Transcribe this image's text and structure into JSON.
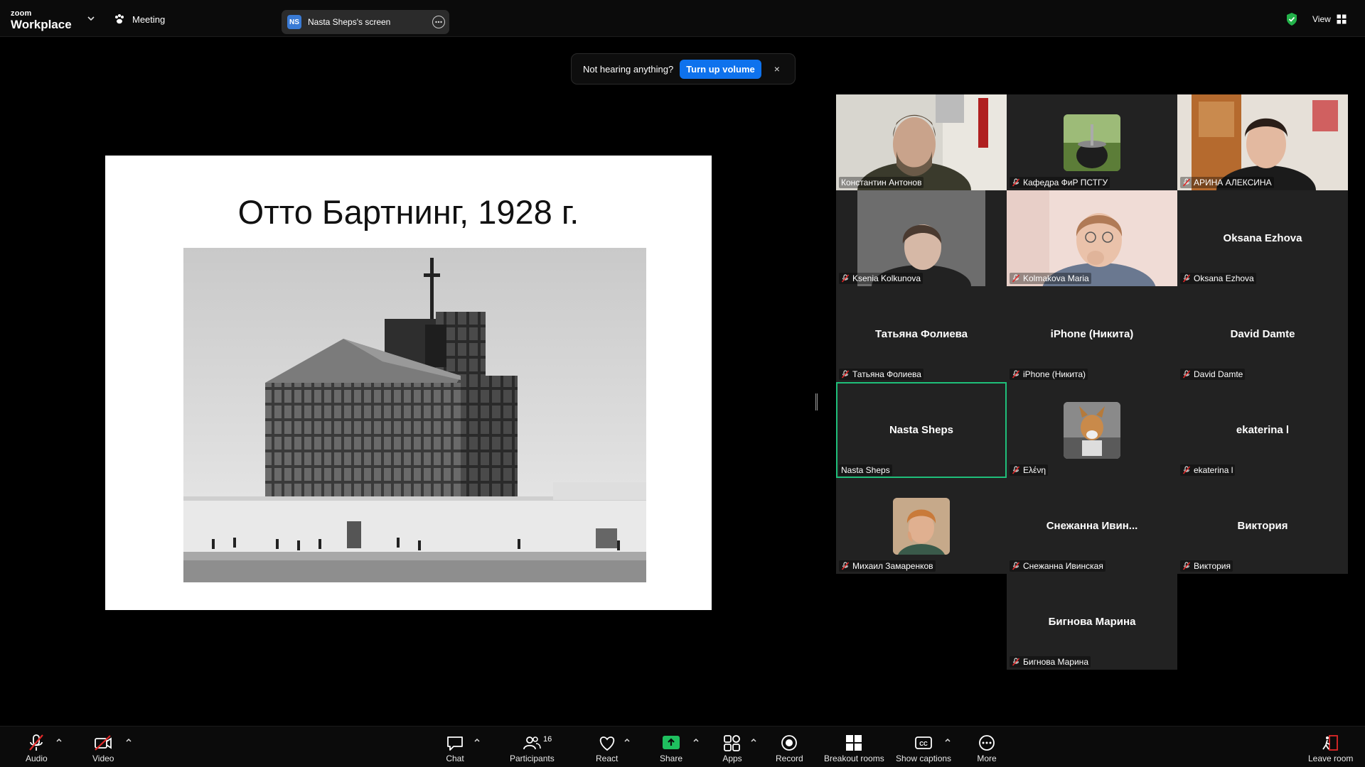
{
  "app": {
    "brand_small": "zoom",
    "brand_big": "Workplace"
  },
  "topbar": {
    "meeting_label": "Meeting",
    "screen_badge": "NS",
    "screen_title": "Nasta Sheps's screen",
    "view_label": "View"
  },
  "toast": {
    "message": "Not hearing anything?",
    "button": "Turn up volume",
    "close": "×"
  },
  "slide": {
    "title": "Отто Бартнинг, 1928 г."
  },
  "participants": [
    {
      "name": "Константин Антонов",
      "big": "",
      "muted": false,
      "video": "man-beard"
    },
    {
      "name": "Кафедра ФиР ПСТГУ",
      "big": "",
      "muted": true,
      "video": "avatar-mate"
    },
    {
      "name": "АРИНА АЛЕКСИНА",
      "big": "",
      "muted": true,
      "video": "woman-room"
    },
    {
      "name": "Ksenia Kolkunova",
      "big": "",
      "muted": true,
      "video": "woman-gray"
    },
    {
      "name": "Kolmakova Maria",
      "big": "",
      "muted": true,
      "video": "woman-pink"
    },
    {
      "name": "Oksana Ezhova",
      "big": "Oksana Ezhova",
      "muted": true,
      "video": ""
    },
    {
      "name": "Татьяна Фолиева",
      "big": "Татьяна Фолиева",
      "muted": true,
      "video": ""
    },
    {
      "name": "iPhone (Никита)",
      "big": "iPhone (Никита)",
      "muted": true,
      "video": ""
    },
    {
      "name": "David Damte",
      "big": "David Damte",
      "muted": true,
      "video": ""
    },
    {
      "name": "Nasta Sheps",
      "big": "Nasta Sheps",
      "muted": false,
      "video": "",
      "active": true
    },
    {
      "name": "Ελένη",
      "big": "",
      "muted": true,
      "video": "avatar-dog"
    },
    {
      "name": "ekaterina l",
      "big": "ekaterina l",
      "muted": true,
      "video": ""
    },
    {
      "name": "Михаил Замаренков",
      "big": "",
      "muted": true,
      "video": "avatar-man"
    },
    {
      "name": "Снежанна Ивинская",
      "big": "Снежанна  Ивин...",
      "muted": true,
      "video": ""
    },
    {
      "name": "Виктория",
      "big": "Виктория",
      "muted": true,
      "video": ""
    },
    {
      "name": "Бигнова Марина",
      "big": "Бигнова Марина",
      "muted": true,
      "video": ""
    }
  ],
  "toolbar": {
    "audio": "Audio",
    "video": "Video",
    "chat": "Chat",
    "participants": "Participants",
    "participants_count": "16",
    "react": "React",
    "share": "Share",
    "apps": "Apps",
    "record": "Record",
    "breakout": "Breakout rooms",
    "captions": "Show captions",
    "more": "More",
    "leave": "Leave room"
  },
  "colors": {
    "accent": "#0e72ed",
    "share_green": "#1fbf5f",
    "active_border": "#1fbf7a",
    "muted_red": "#e02828"
  }
}
